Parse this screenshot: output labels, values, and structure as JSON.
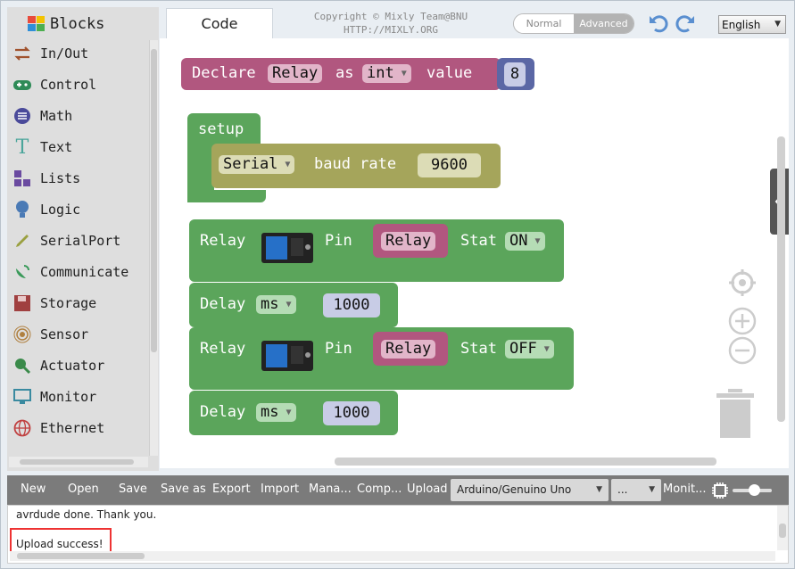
{
  "sidebar": {
    "title": "Blocks",
    "categories": [
      {
        "label": "In/Out",
        "icon": "arrows-icon",
        "color": "#a0522d"
      },
      {
        "label": "Control",
        "icon": "gamepad-icon",
        "color": "#2e8b57"
      },
      {
        "label": "Math",
        "icon": "math-icon",
        "color": "#4a4a9a"
      },
      {
        "label": "Text",
        "icon": "text-icon",
        "color": "#4aa59b"
      },
      {
        "label": "Lists",
        "icon": "lists-icon",
        "color": "#6a4aa0"
      },
      {
        "label": "Logic",
        "icon": "bulb-icon",
        "color": "#4a7ab5"
      },
      {
        "label": "SerialPort",
        "icon": "pen-icon",
        "color": "#9aa040"
      },
      {
        "label": "Communicate",
        "icon": "satellite-icon",
        "color": "#3a9a5a"
      },
      {
        "label": "Storage",
        "icon": "floppy-icon",
        "color": "#a04040"
      },
      {
        "label": "Sensor",
        "icon": "sensor-icon",
        "color": "#b08040"
      },
      {
        "label": "Actuator",
        "icon": "actuator-icon",
        "color": "#3a8a4a"
      },
      {
        "label": "Monitor",
        "icon": "monitor-icon",
        "color": "#3a8aa0"
      },
      {
        "label": "Ethernet",
        "icon": "globe-icon",
        "color": "#c04040"
      }
    ]
  },
  "header": {
    "tab_code": "Code",
    "copyright_line1": "Copyright © Mixly Team@BNU",
    "copyright_line2": "HTTP://MIXLY.ORG",
    "mode_normal": "Normal",
    "mode_advanced": "Advanced",
    "language": "English"
  },
  "blocks": {
    "declare": {
      "t1": "Declare",
      "var": "Relay",
      "t2": "as",
      "type": "int",
      "t3": "value",
      "num": "8"
    },
    "setup": {
      "label": "setup",
      "serial": "Serial",
      "baud_label": "baud rate",
      "baud": "9600"
    },
    "relay1": {
      "t1": "Relay",
      "pin_label": "Pin",
      "pin": "Relay",
      "stat_label": "Stat",
      "stat": "ON"
    },
    "delay1": {
      "t1": "Delay",
      "unit": "ms",
      "val": "1000"
    },
    "relay2": {
      "t1": "Relay",
      "pin_label": "Pin",
      "pin": "Relay",
      "stat_label": "Stat",
      "stat": "OFF"
    },
    "delay2": {
      "t1": "Delay",
      "unit": "ms",
      "val": "1000"
    }
  },
  "toolbar": {
    "new": "New",
    "open": "Open",
    "save": "Save",
    "save_as": "Save as",
    "export": "Export",
    "import": "Import",
    "manage": "Mana...",
    "compile": "Comp...",
    "upload": "Upload",
    "board": "Arduino/Genuino Uno",
    "port": "...",
    "monitor": "Monit..."
  },
  "console": {
    "line1": "avrdude done.  Thank you.",
    "line2": "Upload success!"
  },
  "colors": {
    "var_block": "#b1577f",
    "math_block": "#5b67a5",
    "setup_block": "#5ba55b",
    "serial_block": "#a5a55b",
    "highlight": "#e33333"
  }
}
